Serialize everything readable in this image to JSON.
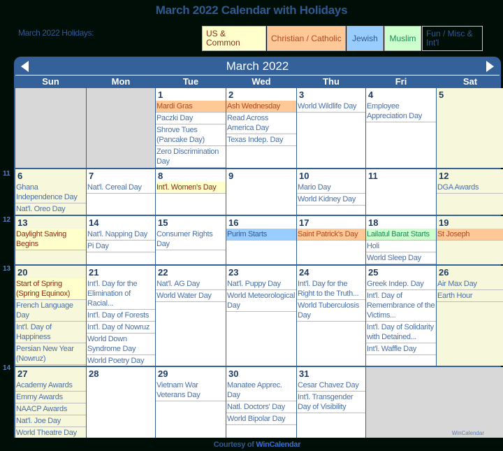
{
  "page": {
    "title": "March 2022 Calendar with Holidays",
    "holidays_label": "March 2022 Holidays:"
  },
  "legend": [
    {
      "key": "us",
      "label": "US & Common",
      "color": "#ffffcc"
    },
    {
      "key": "christian",
      "label": "Christian / Catholic",
      "color": "#ffc896"
    },
    {
      "key": "jewish",
      "label": "Jewish",
      "color": "#99ccff"
    },
    {
      "key": "muslim",
      "label": "Muslim",
      "color": "#ccffcc"
    },
    {
      "key": "fun",
      "label": "Fun / Misc & Int'l",
      "color": "#000e08"
    }
  ],
  "calendar": {
    "month_label": "March 2022",
    "prev_icon": "triangle-left",
    "next_icon": "triangle-right",
    "weekdays": [
      "Sun",
      "Mon",
      "Tue",
      "Wed",
      "Thu",
      "Fri",
      "Sat"
    ],
    "week_numbers": [
      "11",
      "12",
      "13",
      "14"
    ],
    "watermark": "WinCalendar",
    "accent_color": "#34619a",
    "weeks": [
      [
        {
          "empty": true
        },
        {
          "empty": true
        },
        {
          "day": "1",
          "events": [
            {
              "text": "Mardi Gras",
              "type": "christian"
            },
            {
              "text": "Paczki Day",
              "type": "plain"
            },
            {
              "text": "Shrove Tues (Pancake Day)",
              "type": "plain"
            },
            {
              "text": "Zero Discrimination Day",
              "type": "plain"
            }
          ]
        },
        {
          "day": "2",
          "events": [
            {
              "text": "Ash Wednesday",
              "type": "christian"
            },
            {
              "text": "Read Across America Day",
              "type": "plain"
            },
            {
              "text": "Texas Indep. Day",
              "type": "plain"
            }
          ]
        },
        {
          "day": "3",
          "events": [
            {
              "text": "World Wildlife Day",
              "type": "plain"
            }
          ]
        },
        {
          "day": "4",
          "events": [
            {
              "text": "Employee Appreciation Day",
              "type": "plain"
            }
          ]
        },
        {
          "day": "5",
          "weekend": true,
          "events": []
        }
      ],
      [
        {
          "day": "6",
          "weekend": true,
          "events": [
            {
              "text": "Ghana Independence Day",
              "type": "plain"
            },
            {
              "text": "Nat'l. Oreo Day",
              "type": "plain"
            }
          ]
        },
        {
          "day": "7",
          "events": [
            {
              "text": "Nat'l. Cereal Day",
              "type": "plain"
            }
          ]
        },
        {
          "day": "8",
          "events": [
            {
              "text": "Int'l. Women's Day",
              "type": "us"
            }
          ]
        },
        {
          "day": "9",
          "events": []
        },
        {
          "day": "10",
          "events": [
            {
              "text": "Mario Day",
              "type": "plain"
            },
            {
              "text": "World Kidney Day",
              "type": "plain"
            }
          ]
        },
        {
          "day": "11",
          "events": []
        },
        {
          "day": "12",
          "weekend": true,
          "events": [
            {
              "text": "DGA Awards",
              "type": "plain"
            }
          ]
        }
      ],
      [
        {
          "day": "13",
          "weekend": true,
          "events": [
            {
              "text": "Daylight Saving Begins",
              "type": "us"
            }
          ]
        },
        {
          "day": "14",
          "events": [
            {
              "text": "Nat'l. Napping Day",
              "type": "plain"
            },
            {
              "text": "Pi Day",
              "type": "plain"
            }
          ]
        },
        {
          "day": "15",
          "events": [
            {
              "text": "Consumer Rights Day",
              "type": "plain"
            }
          ]
        },
        {
          "day": "16",
          "events": [
            {
              "text": "Purim Starts",
              "type": "jewish"
            }
          ]
        },
        {
          "day": "17",
          "events": [
            {
              "text": "Saint Patrick's Day",
              "type": "christian"
            }
          ]
        },
        {
          "day": "18",
          "events": [
            {
              "text": "Lailatul Barat Starts",
              "type": "muslim"
            },
            {
              "text": "Holi",
              "type": "plain"
            },
            {
              "text": "World Sleep Day",
              "type": "plain"
            }
          ]
        },
        {
          "day": "19",
          "weekend": true,
          "events": [
            {
              "text": "St Joseph",
              "type": "christian"
            }
          ]
        }
      ],
      [
        {
          "day": "20",
          "weekend": true,
          "events": [
            {
              "text": "Start of Spring (Spring Equinox)",
              "type": "us"
            },
            {
              "text": "French Language Day",
              "type": "plain"
            },
            {
              "text": "Int'l. Day of Happiness",
              "type": "plain"
            },
            {
              "text": "Persian New Year (Nowruz)",
              "type": "plain"
            }
          ]
        },
        {
          "day": "21",
          "events": [
            {
              "text": "Int'l. Day for the Elimination of Racial...",
              "type": "plain"
            },
            {
              "text": "Int'l. Day of Forests",
              "type": "plain"
            },
            {
              "text": "Int'l. Day of Nowruz",
              "type": "plain"
            },
            {
              "text": "World Down Syndrome Day",
              "type": "plain"
            },
            {
              "text": "World Poetry Day",
              "type": "plain"
            }
          ]
        },
        {
          "day": "22",
          "events": [
            {
              "text": "Nat'l. AG Day",
              "type": "plain"
            },
            {
              "text": "World Water Day",
              "type": "plain"
            }
          ]
        },
        {
          "day": "23",
          "events": [
            {
              "text": "Nat'l. Puppy Day",
              "type": "plain"
            },
            {
              "text": "World Meteorological Day",
              "type": "plain"
            }
          ]
        },
        {
          "day": "24",
          "events": [
            {
              "text": "Int'l. Day for the Right to the Truth...",
              "type": "plain"
            },
            {
              "text": "World Tuberculosis Day",
              "type": "plain"
            }
          ]
        },
        {
          "day": "25",
          "events": [
            {
              "text": "Greek Indep. Day",
              "type": "plain"
            },
            {
              "text": "Int'l. Day of Remembrance of the Victims...",
              "type": "plain"
            },
            {
              "text": "Int'l. Day of Solidarity with Detained...",
              "type": "plain"
            },
            {
              "text": "Int'l. Waffle Day",
              "type": "plain"
            }
          ]
        },
        {
          "day": "26",
          "weekend": true,
          "events": [
            {
              "text": "Air Max Day",
              "type": "plain"
            },
            {
              "text": "Earth Hour",
              "type": "plain"
            }
          ]
        }
      ],
      [
        {
          "day": "27",
          "weekend": true,
          "events": [
            {
              "text": "Academy Awards",
              "type": "plain"
            },
            {
              "text": "Emmy Awards",
              "type": "plain"
            },
            {
              "text": "NAACP Awards",
              "type": "plain"
            },
            {
              "text": "Nat'l. Joe Day",
              "type": "plain"
            },
            {
              "text": "World Theatre Day",
              "type": "plain"
            }
          ]
        },
        {
          "day": "28",
          "events": []
        },
        {
          "day": "29",
          "events": [
            {
              "text": "Vietnam War Veterans Day",
              "type": "plain"
            }
          ]
        },
        {
          "day": "30",
          "events": [
            {
              "text": "Manatee Apprec. Day",
              "type": "plain"
            },
            {
              "text": "Natl. Doctors' Day",
              "type": "plain"
            },
            {
              "text": "World Bipolar Day",
              "type": "plain"
            }
          ]
        },
        {
          "day": "31",
          "events": [
            {
              "text": "Cesar Chavez Day",
              "type": "plain"
            },
            {
              "text": "Int'l. Transgender Day of Visibility",
              "type": "plain"
            }
          ]
        },
        {
          "empty": true,
          "span": 2,
          "watermark": true
        }
      ]
    ]
  },
  "footer": {
    "prefix": "Courtesy of ",
    "link": "WinCalendar"
  }
}
